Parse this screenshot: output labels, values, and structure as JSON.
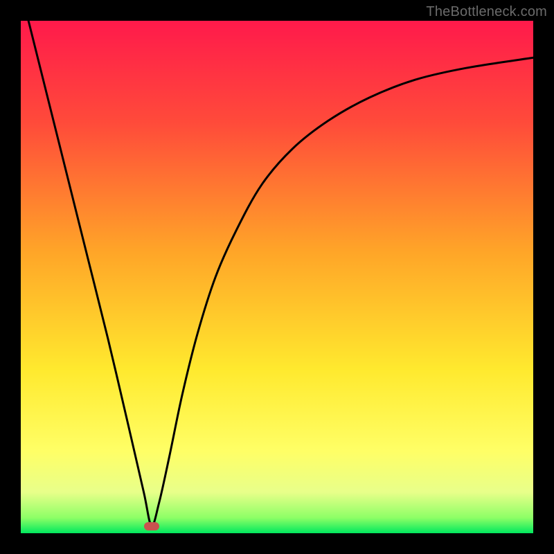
{
  "watermark": {
    "text": "TheBottleneck.com"
  },
  "gradient": {
    "stops": [
      {
        "pct": 0,
        "color": "#ff1a4b"
      },
      {
        "pct": 20,
        "color": "#ff4b3a"
      },
      {
        "pct": 45,
        "color": "#ffa528"
      },
      {
        "pct": 68,
        "color": "#ffe92e"
      },
      {
        "pct": 84,
        "color": "#ffff66"
      },
      {
        "pct": 92,
        "color": "#e8ff8a"
      },
      {
        "pct": 97,
        "color": "#8dff66"
      },
      {
        "pct": 100,
        "color": "#00e85e"
      }
    ]
  },
  "trough_marker": {
    "x_fraction": 0.255,
    "y_fraction": 0.986,
    "color": "#c9534f"
  },
  "chart_data": {
    "type": "line",
    "title": "",
    "xlabel": "",
    "ylabel": "",
    "xlim": [
      0,
      1
    ],
    "ylim": [
      0,
      1
    ],
    "series": [
      {
        "name": "curve",
        "x": [
          0.015,
          0.05,
          0.09,
          0.13,
          0.17,
          0.21,
          0.24,
          0.255,
          0.27,
          0.29,
          0.315,
          0.345,
          0.38,
          0.42,
          0.47,
          0.53,
          0.6,
          0.68,
          0.77,
          0.87,
          1.0
        ],
        "y": [
          1.0,
          0.86,
          0.7,
          0.54,
          0.38,
          0.21,
          0.08,
          0.015,
          0.06,
          0.15,
          0.27,
          0.39,
          0.5,
          0.59,
          0.68,
          0.75,
          0.805,
          0.85,
          0.885,
          0.908,
          0.928
        ]
      }
    ],
    "note": "x and y are normalized fractions of the plot box; y measured from bottom (0) to top (1). Curve descends steeply from top-left, reaches a minimum near x≈0.255, then rises asymptotically toward the upper right."
  }
}
